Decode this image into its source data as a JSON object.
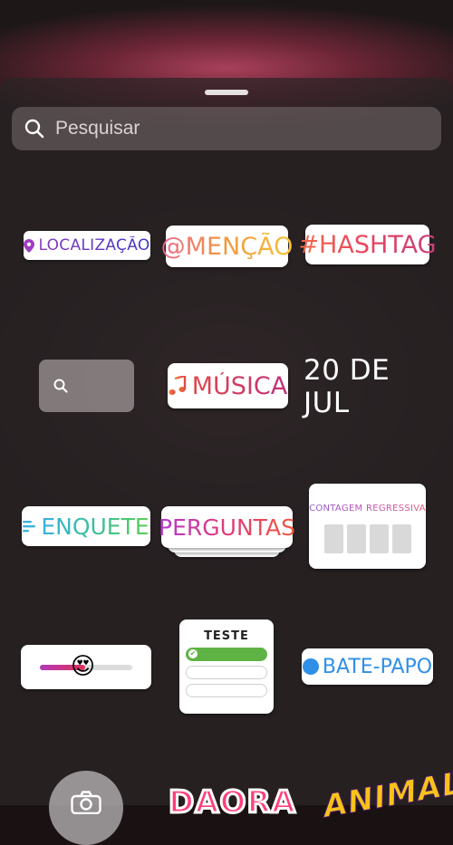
{
  "search": {
    "placeholder": "Pesquisar",
    "icon": "search-icon"
  },
  "stickers": {
    "location": {
      "label": "LOCALIZAÇÃO",
      "icon": "location-pin-icon"
    },
    "mention": {
      "label": "@MENÇÃO"
    },
    "hashtag": {
      "label": "#HASHTAG"
    },
    "gif_search": {
      "icon": "search-icon"
    },
    "music": {
      "label": "MÚSICA",
      "icon": "music-note-icon"
    },
    "date": {
      "label": "20 DE JUL"
    },
    "poll": {
      "label": "ENQUETE",
      "icon": "poll-lines-icon"
    },
    "questions": {
      "label": "PERGUNTAS"
    },
    "countdown": {
      "label": "CONTAGEM REGRESSIVA"
    },
    "emoji_slider": {
      "emoji": "😍",
      "level": 0.5
    },
    "quiz": {
      "label": "TESTE"
    },
    "chat": {
      "label": "BATE-PAPO",
      "icon": "chat-bubble-icon"
    },
    "camera": {
      "icon": "camera-icon"
    },
    "partial_1": {
      "label": "DAORA"
    },
    "partial_2": {
      "label": "ANIMAL"
    }
  },
  "colors": {
    "chat_blue": "#2f8fe8",
    "quiz_green": "#5fb344"
  }
}
